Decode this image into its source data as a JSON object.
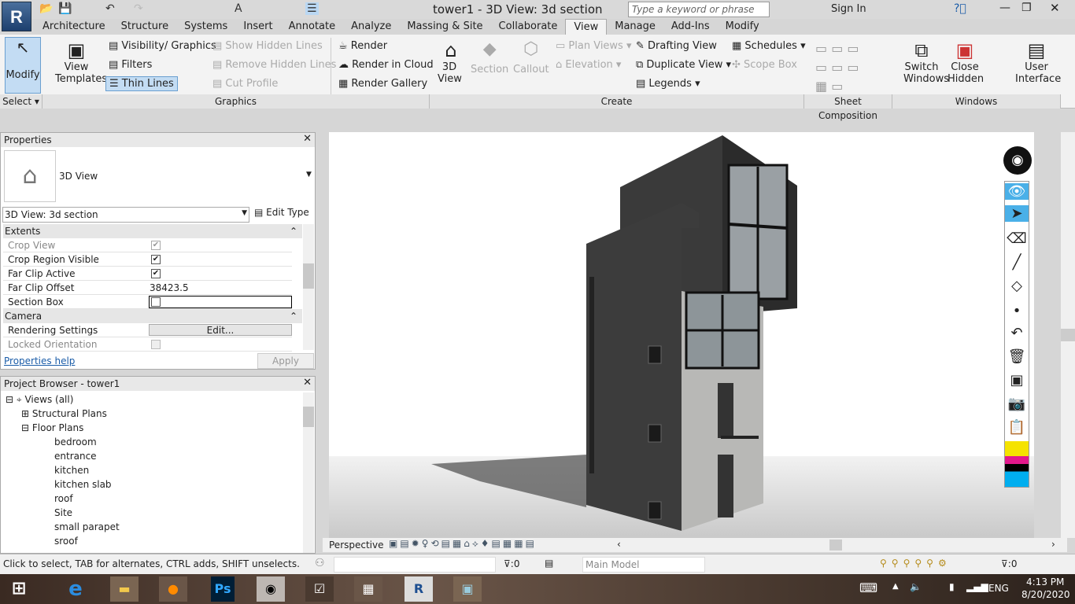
{
  "app": {
    "logo": "R",
    "title": "tower1 - 3D View: 3d section",
    "search_placeholder": "Type a keyword or phrase",
    "sign_in": "Sign In"
  },
  "tabs": [
    {
      "label": "Architecture"
    },
    {
      "label": "Structure"
    },
    {
      "label": "Systems"
    },
    {
      "label": "Insert"
    },
    {
      "label": "Annotate"
    },
    {
      "label": "Analyze"
    },
    {
      "label": "Massing & Site"
    },
    {
      "label": "Collaborate"
    },
    {
      "label": "View",
      "active": true
    },
    {
      "label": "Manage"
    },
    {
      "label": "Add-Ins"
    },
    {
      "label": "Modify"
    }
  ],
  "ribbon": {
    "modify": "Modify",
    "select": "Select",
    "view_templates": "View Templates",
    "visibility": "Visibility/ Graphics",
    "filters": "Filters",
    "thin_lines": "Thin Lines",
    "show_hidden": "Show Hidden Lines",
    "remove_hidden": "Remove Hidden Lines",
    "cut_profile": "Cut Profile",
    "render": "Render",
    "render_cloud": "Render in Cloud",
    "render_gallery": "Render Gallery",
    "view3d": "3D View",
    "section": "Section",
    "callout": "Callout",
    "plan_views": "Plan Views",
    "elevation": "Elevation",
    "drafting": "Drafting View",
    "duplicate": "Duplicate View",
    "legends": "Legends",
    "schedules": "Schedules",
    "scope_box": "Scope Box",
    "switch_windows": "Switch Windows",
    "close_hidden": "Close Hidden",
    "user_interface": "User Interface",
    "panels": {
      "graphics": "Graphics",
      "create": "Create",
      "sheet": "Sheet Composition",
      "windows": "Windows"
    }
  },
  "properties": {
    "title": "Properties",
    "type": "3D View",
    "selector": "3D View: 3d section",
    "edit_type": "Edit Type",
    "groups": {
      "extents": "Extents",
      "camera": "Camera"
    },
    "rows": [
      {
        "k": "Crop View",
        "checked": true,
        "disabled": true
      },
      {
        "k": "Crop Region Visible",
        "checked": true
      },
      {
        "k": "Far Clip Active",
        "checked": true
      },
      {
        "k": "Far Clip Offset",
        "v": "38423.5"
      },
      {
        "k": "Section Box",
        "checked": false
      },
      {
        "k": "Rendering Settings",
        "v": "Edit..."
      },
      {
        "k": "Locked Orientation",
        "checked": false,
        "disabled": true
      }
    ],
    "help": "Properties help",
    "apply": "Apply"
  },
  "browser": {
    "title": "Project Browser - tower1",
    "root": "Views (all)",
    "structural": "Structural Plans",
    "floor": "Floor Plans",
    "items": [
      "bedroom",
      "entrance",
      "kitchen",
      "kitchen slab",
      "roof",
      "Site",
      "small parapet",
      "sroof"
    ]
  },
  "viewbar": {
    "mode": "Perspective"
  },
  "status": {
    "hint": "Click to select, TAB for alternates, CTRL adds, SHIFT unselects.",
    "count": ":0",
    "model": "Main Model",
    "filter": ":0"
  },
  "taskbar": {
    "lang": "ENG",
    "time": "4:13 PM",
    "date": "8/20/2020"
  }
}
